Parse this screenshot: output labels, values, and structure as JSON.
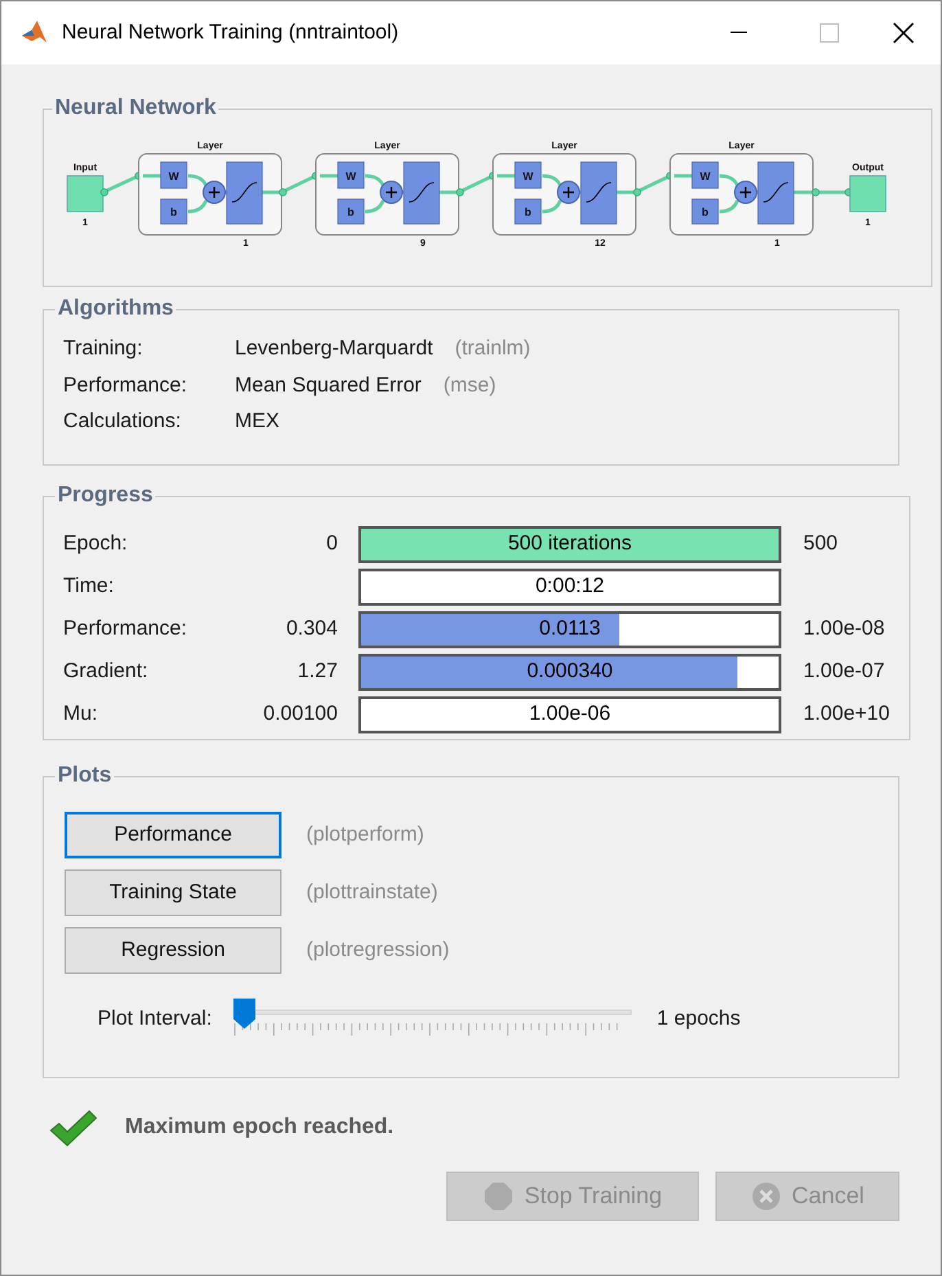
{
  "window": {
    "title": "Neural Network Training (nntraintool)"
  },
  "network": {
    "title": "Neural Network",
    "input": {
      "label": "Input",
      "size": "1"
    },
    "output": {
      "label": "Output",
      "size": "1"
    },
    "layers": [
      {
        "label": "Layer",
        "weight": "W",
        "bias": "b",
        "size": "1"
      },
      {
        "label": "Layer",
        "weight": "W",
        "bias": "b",
        "size": "9"
      },
      {
        "label": "Layer",
        "weight": "W",
        "bias": "b",
        "size": "12"
      },
      {
        "label": "Layer",
        "weight": "W",
        "bias": "b",
        "size": "1"
      }
    ]
  },
  "algorithms": {
    "title": "Algorithms",
    "rows": [
      {
        "label": "Training:",
        "value": "Levenberg-Marquardt",
        "code": "(trainlm)"
      },
      {
        "label": "Performance:",
        "value": "Mean Squared Error",
        "code": "(mse)"
      },
      {
        "label": "Calculations:",
        "value": "MEX"
      }
    ]
  },
  "progress": {
    "title": "Progress",
    "rows": [
      {
        "label": "Epoch:",
        "start": "0",
        "bar_text": "500 iterations",
        "level": 1,
        "kind": "done",
        "end": "500"
      },
      {
        "label": "Time:",
        "bar_text": "0:00:12",
        "level": 0,
        "kind": "value"
      },
      {
        "label": "Performance:",
        "start": "0.304",
        "bar_text": "0.0113",
        "level": 0.62,
        "kind": "value",
        "end": "1.00e-08"
      },
      {
        "label": "Gradient:",
        "start": "1.27",
        "bar_text": "0.000340",
        "level": 0.9,
        "kind": "value",
        "end": "1.00e-07"
      },
      {
        "label": "Mu:",
        "start": "0.00100",
        "bar_text": "1.00e-06",
        "level": 0,
        "kind": "value",
        "end": "1.00e+10"
      }
    ]
  },
  "plots": {
    "title": "Plots",
    "buttons": [
      {
        "label": "Performance",
        "code": "(plotperform)",
        "selected": true
      },
      {
        "label": "Training State",
        "code": "(plottrainstate)",
        "selected": false
      },
      {
        "label": "Regression",
        "code": "(plotregression)",
        "selected": false
      }
    ],
    "interval": {
      "label": "Plot Interval:",
      "level": 0,
      "reading": "1 epochs"
    }
  },
  "status": {
    "message": "Maximum epoch reached."
  },
  "buttons": [
    {
      "label": "Stop Training",
      "kind": "stop",
      "disabled": true
    },
    {
      "label": "Cancel",
      "kind": "cancel",
      "disabled": true
    }
  ]
}
